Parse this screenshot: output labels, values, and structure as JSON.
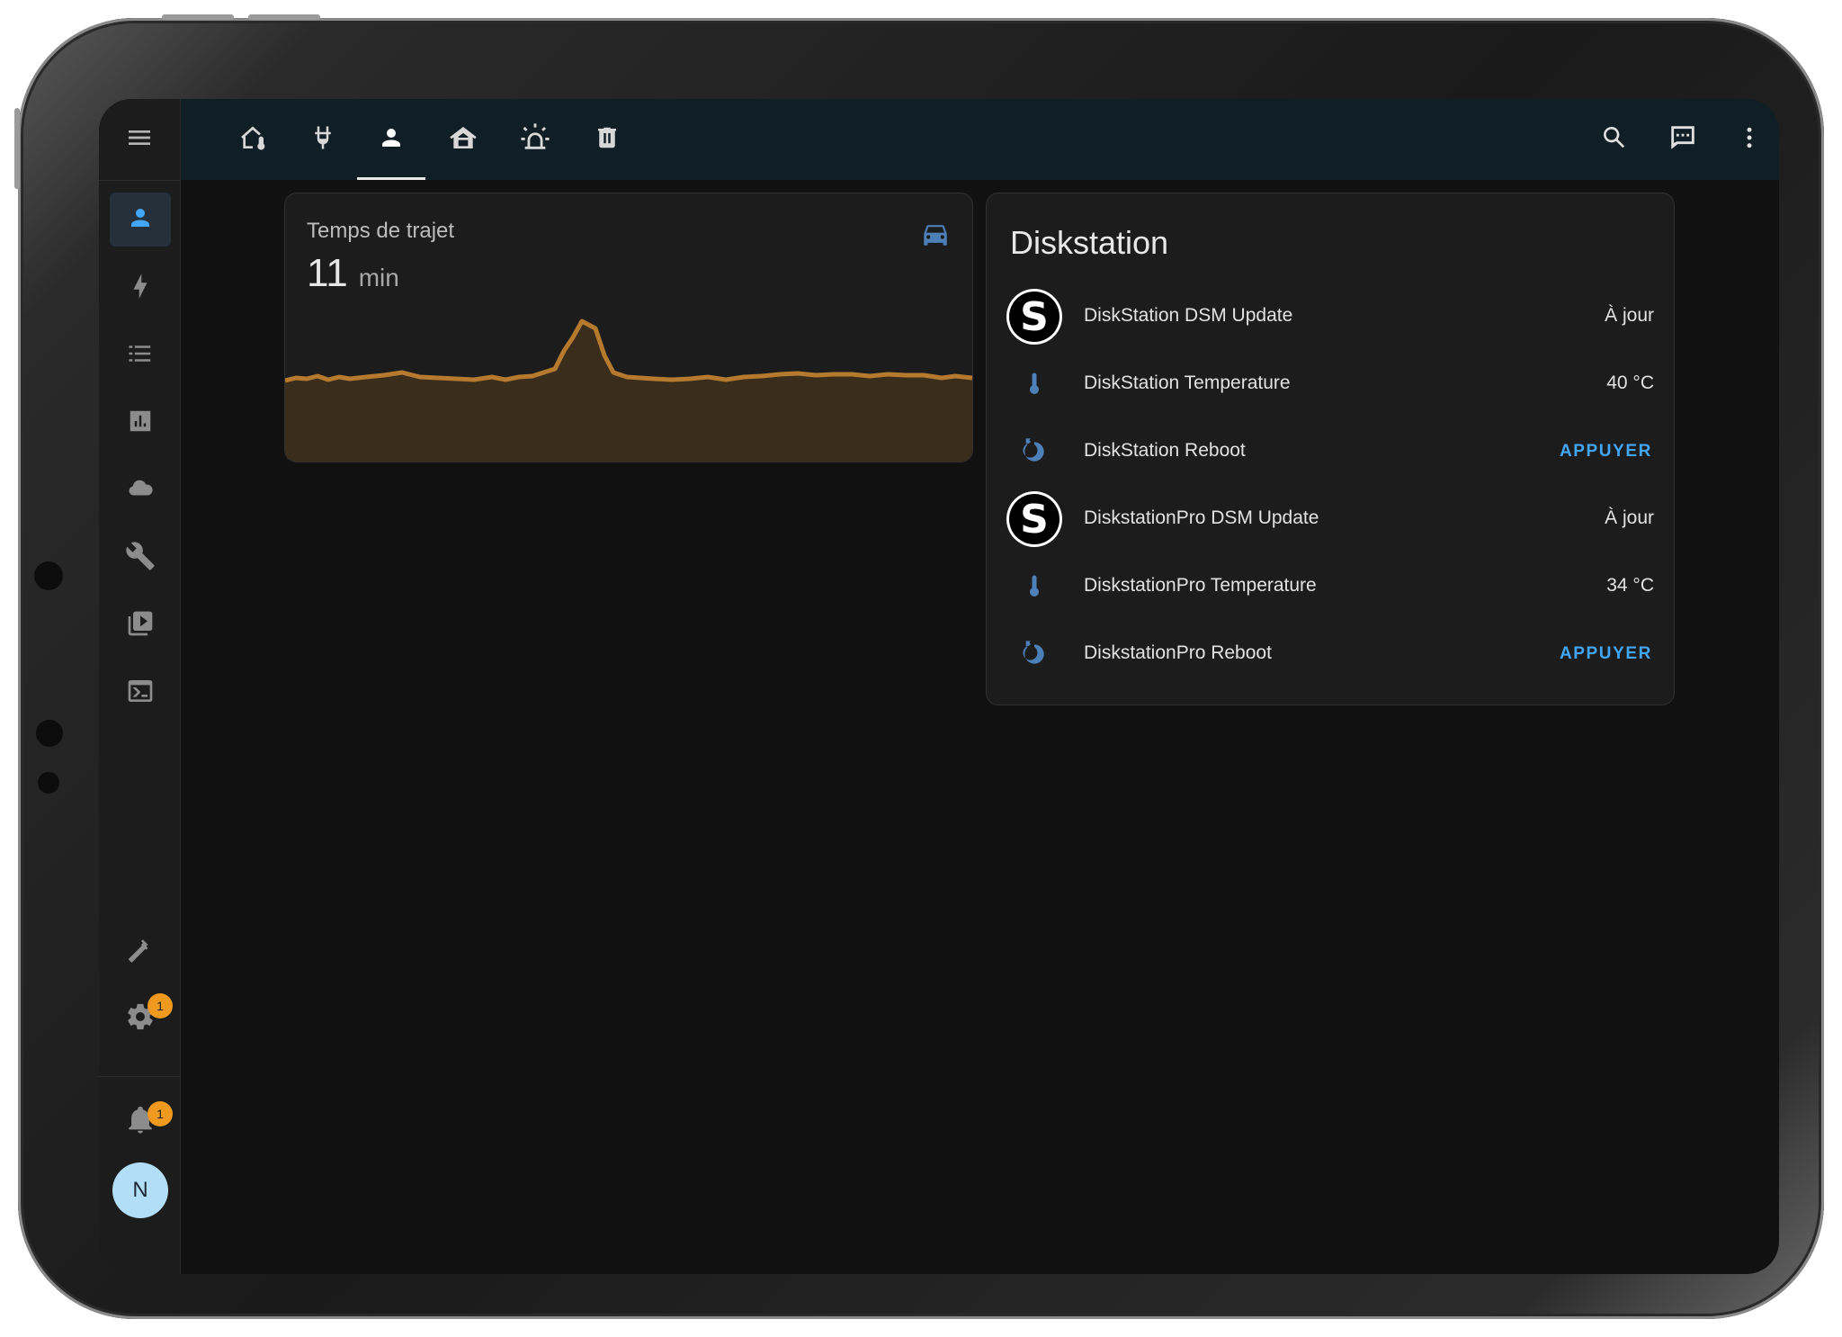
{
  "toolbar": {
    "menu_icon": "menu-icon",
    "tabs": [
      {
        "icon": "home-thermometer-icon",
        "active": false
      },
      {
        "icon": "power-plug-icon",
        "active": false
      },
      {
        "icon": "account-icon",
        "active": true
      },
      {
        "icon": "home-roof-icon",
        "active": false
      },
      {
        "icon": "alarm-light-icon",
        "active": false
      },
      {
        "icon": "trash-can-icon",
        "active": false
      }
    ],
    "actions": [
      "search-icon",
      "assist-chat-icon",
      "more-vertical-icon"
    ]
  },
  "sidebar": {
    "items": [
      {
        "icon": "account-icon",
        "active": true
      },
      {
        "icon": "lightning-bolt-icon",
        "active": false
      },
      {
        "icon": "format-list-icon",
        "active": false
      },
      {
        "icon": "chart-box-icon",
        "active": false
      },
      {
        "icon": "cloud-icon",
        "active": false
      },
      {
        "icon": "wrench-icon",
        "active": false
      },
      {
        "icon": "play-box-multiple-icon",
        "active": false
      },
      {
        "icon": "console-icon",
        "active": false
      }
    ],
    "developer_icon": "hammer-icon",
    "settings_icon": "cog-icon",
    "settings_badge": "1",
    "notifications_icon": "bell-icon",
    "notifications_badge": "1",
    "user_initial": "N"
  },
  "sensor_card": {
    "name": "Temps de trajet",
    "value": "11",
    "unit": "min",
    "icon": "car-icon",
    "line_color": "#b57a2e"
  },
  "entities_card": {
    "title": "Diskstation",
    "rows": [
      {
        "icon": "synology-s-logo",
        "name": "DiskStation DSM Update",
        "state": "À jour",
        "button": null
      },
      {
        "icon": "thermometer-icon",
        "name": "DiskStation Temperature",
        "state": "40 °C",
        "button": null
      },
      {
        "icon": "restart-icon",
        "name": "DiskStation Reboot",
        "state": null,
        "button": "APPUYER"
      },
      {
        "icon": "synology-s-logo",
        "name": "DiskstationPro DSM Update",
        "state": "À jour",
        "button": null
      },
      {
        "icon": "thermometer-icon",
        "name": "DiskstationPro Temperature",
        "state": "34 °C",
        "button": null
      },
      {
        "icon": "restart-icon",
        "name": "DiskstationPro Reboot",
        "state": null,
        "button": "APPUYER"
      }
    ],
    "logo_letter": "S"
  },
  "colors": {
    "accent": "#42a5f5",
    "icon_blue": "#4d7fb8",
    "badge": "#ef9a1f",
    "topbar": "#101e26"
  }
}
